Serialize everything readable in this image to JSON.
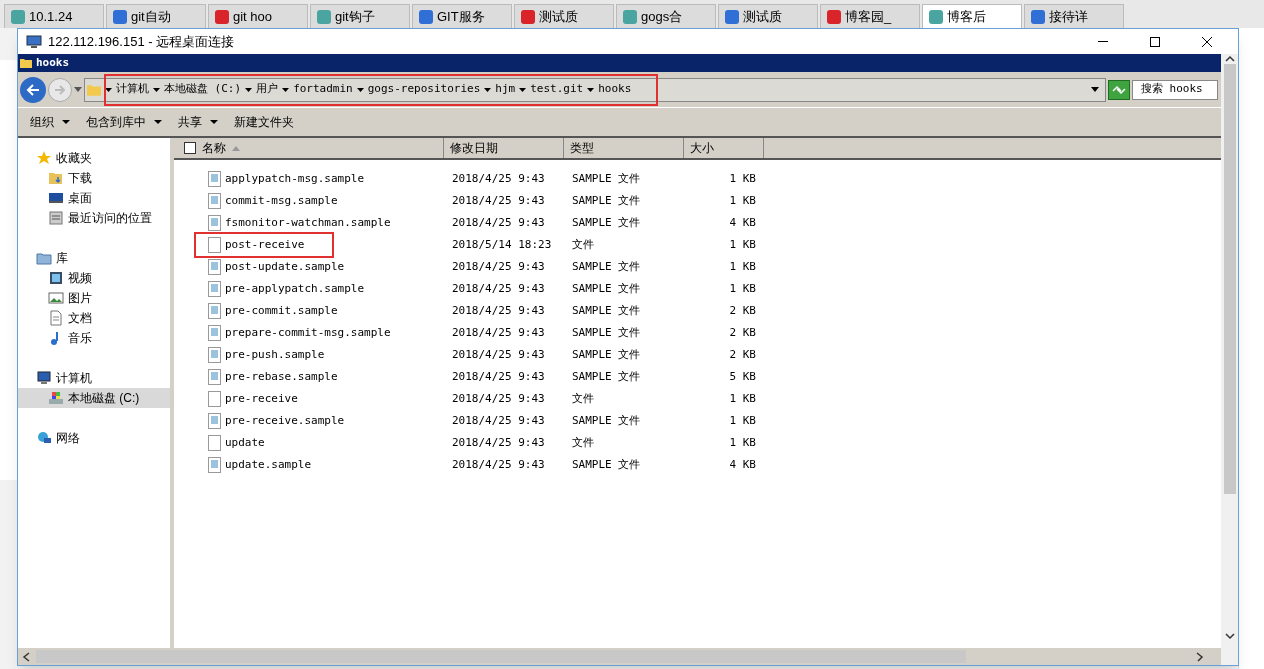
{
  "browser_tabs": [
    {
      "label": "10.1.24",
      "selected": false
    },
    {
      "label": "git自动",
      "selected": false
    },
    {
      "label": "git hoo",
      "selected": false
    },
    {
      "label": "git钩子",
      "selected": false
    },
    {
      "label": "GIT服务",
      "selected": false
    },
    {
      "label": "测试质",
      "selected": false
    },
    {
      "label": "gogs合",
      "selected": false
    },
    {
      "label": "测试质",
      "selected": false
    },
    {
      "label": "博客园_",
      "selected": false
    },
    {
      "label": "博客后",
      "selected": true
    },
    {
      "label": "接待详",
      "selected": false
    }
  ],
  "window": {
    "title": "122.112.196.151 - 远程桌面连接"
  },
  "explorer": {
    "title": "hooks",
    "address": {
      "highlighted": true,
      "crumbs": [
        "计算机",
        "本地磁盘 (C:)",
        "用户",
        "fortadmin",
        "gogs-repositories",
        "hjm",
        "test.git",
        "hooks"
      ]
    },
    "search": {
      "placeholder": "搜索 hooks"
    },
    "toolbar": [
      {
        "label": "组织",
        "dropdown": true
      },
      {
        "label": "包含到库中",
        "dropdown": true
      },
      {
        "label": "共享",
        "dropdown": true
      },
      {
        "label": "新建文件夹",
        "dropdown": false
      }
    ],
    "sidebar": [
      {
        "label": "收藏夹",
        "selected": false,
        "children": [
          {
            "label": "下载",
            "selected": false
          },
          {
            "label": "桌面",
            "selected": false
          },
          {
            "label": "最近访问的位置",
            "selected": false
          }
        ]
      },
      {
        "label": "库",
        "selected": false,
        "children": [
          {
            "label": "视频",
            "selected": false
          },
          {
            "label": "图片",
            "selected": false
          },
          {
            "label": "文档",
            "selected": false
          },
          {
            "label": "音乐",
            "selected": false
          }
        ]
      },
      {
        "label": "计算机",
        "selected": false,
        "children": [
          {
            "label": "本地磁盘 (C:)",
            "selected": true
          }
        ]
      },
      {
        "label": "网络",
        "selected": false
      }
    ],
    "select_all": {
      "checked": false
    },
    "columns": [
      "名称",
      "修改日期",
      "类型",
      "大小"
    ],
    "files": [
      {
        "name": "applypatch-msg.sample",
        "date": "2018/4/25 9:43",
        "type": "SAMPLE 文件",
        "size": "1 KB",
        "kind": "sample",
        "highlighted": false
      },
      {
        "name": "commit-msg.sample",
        "date": "2018/4/25 9:43",
        "type": "SAMPLE 文件",
        "size": "1 KB",
        "kind": "sample",
        "highlighted": false
      },
      {
        "name": "fsmonitor-watchman.sample",
        "date": "2018/4/25 9:43",
        "type": "SAMPLE 文件",
        "size": "4 KB",
        "kind": "sample",
        "highlighted": false
      },
      {
        "name": "post-receive",
        "date": "2018/5/14 18:23",
        "type": "文件",
        "size": "1 KB",
        "kind": "file",
        "highlighted": true
      },
      {
        "name": "post-update.sample",
        "date": "2018/4/25 9:43",
        "type": "SAMPLE 文件",
        "size": "1 KB",
        "kind": "sample",
        "highlighted": false
      },
      {
        "name": "pre-applypatch.sample",
        "date": "2018/4/25 9:43",
        "type": "SAMPLE 文件",
        "size": "1 KB",
        "kind": "sample",
        "highlighted": false
      },
      {
        "name": "pre-commit.sample",
        "date": "2018/4/25 9:43",
        "type": "SAMPLE 文件",
        "size": "2 KB",
        "kind": "sample",
        "highlighted": false
      },
      {
        "name": "prepare-commit-msg.sample",
        "date": "2018/4/25 9:43",
        "type": "SAMPLE 文件",
        "size": "2 KB",
        "kind": "sample",
        "highlighted": false
      },
      {
        "name": "pre-push.sample",
        "date": "2018/4/25 9:43",
        "type": "SAMPLE 文件",
        "size": "2 KB",
        "kind": "sample",
        "highlighted": false
      },
      {
        "name": "pre-rebase.sample",
        "date": "2018/4/25 9:43",
        "type": "SAMPLE 文件",
        "size": "5 KB",
        "kind": "sample",
        "highlighted": false
      },
      {
        "name": "pre-receive",
        "date": "2018/4/25 9:43",
        "type": "文件",
        "size": "1 KB",
        "kind": "file",
        "highlighted": false
      },
      {
        "name": "pre-receive.sample",
        "date": "2018/4/25 9:43",
        "type": "SAMPLE 文件",
        "size": "1 KB",
        "kind": "sample",
        "highlighted": false
      },
      {
        "name": "update",
        "date": "2018/4/25 9:43",
        "type": "文件",
        "size": "1 KB",
        "kind": "file",
        "highlighted": false
      },
      {
        "name": "update.sample",
        "date": "2018/4/25 9:43",
        "type": "SAMPLE 文件",
        "size": "4 KB",
        "kind": "sample",
        "highlighted": false
      }
    ]
  }
}
